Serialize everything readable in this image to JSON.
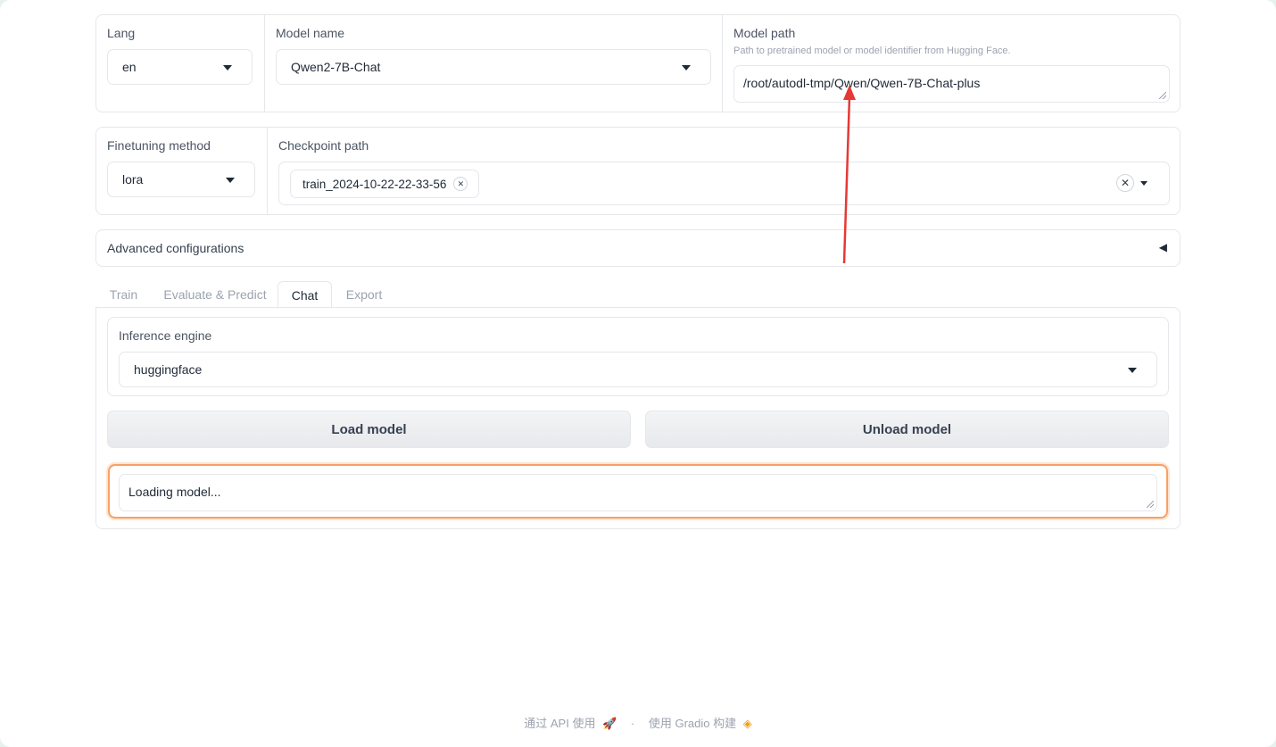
{
  "top_row": {
    "lang": {
      "label": "Lang",
      "value": "en"
    },
    "model_name": {
      "label": "Model name",
      "value": "Qwen2-7B-Chat"
    },
    "model_path": {
      "label": "Model path",
      "info": "Path to pretrained model or model identifier from Hugging Face.",
      "value": "/root/autodl-tmp/Qwen/Qwen-7B-Chat-plus"
    }
  },
  "second_row": {
    "finetuning_method": {
      "label": "Finetuning method",
      "value": "lora"
    },
    "checkpoint_path": {
      "label": "Checkpoint path",
      "chips": [
        "train_2024-10-22-22-33-56"
      ]
    }
  },
  "advanced": {
    "label": "Advanced configurations",
    "toggle": "◀"
  },
  "tabs": [
    "Train",
    "Evaluate & Predict",
    "Chat",
    "Export"
  ],
  "active_tab": "Chat",
  "chat_panel": {
    "inference_engine": {
      "label": "Inference engine",
      "value": "huggingface"
    },
    "load_button": "Load model",
    "unload_button": "Unload model",
    "status_text": "Loading model..."
  },
  "footer": {
    "api_text": "通过 API 使用",
    "separator": "·",
    "built_text": "使用 Gradio 构建"
  },
  "colors": {
    "accent_orange": "#f97316",
    "annotation_arrow": "#e53935",
    "border": "#e5e7eb"
  }
}
